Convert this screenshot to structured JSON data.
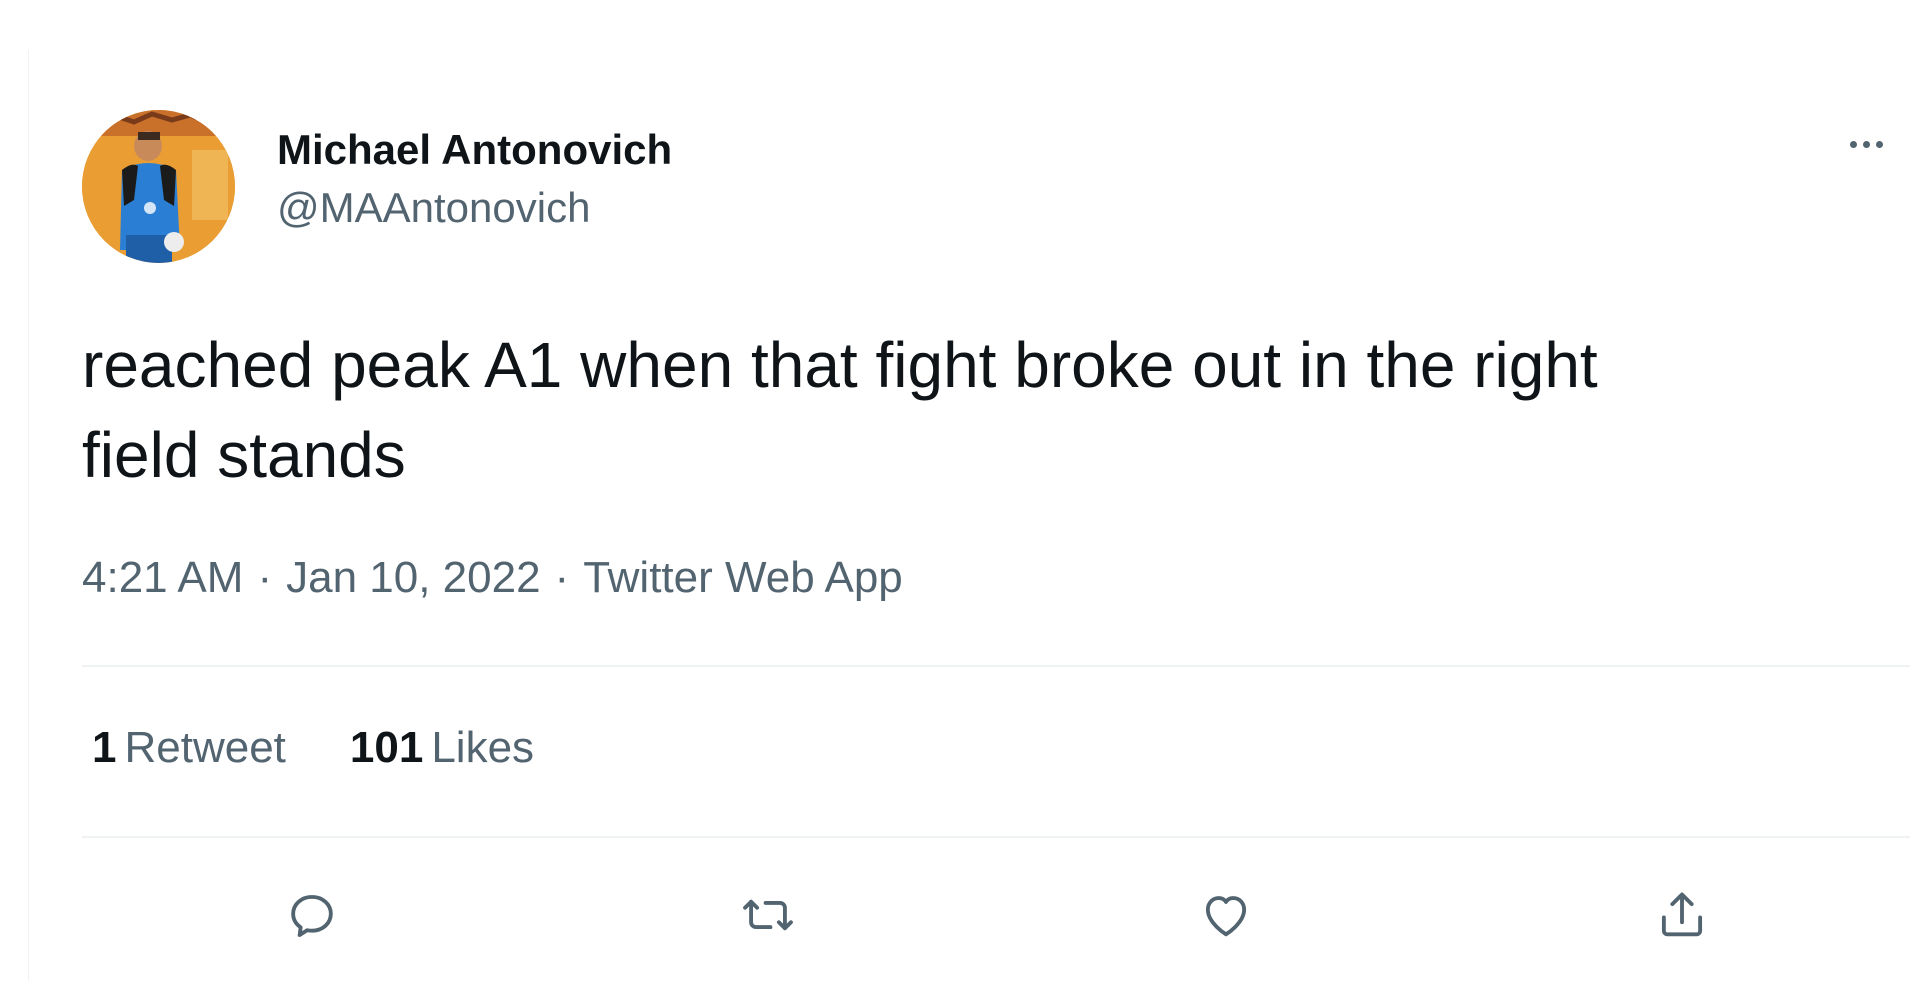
{
  "tweet": {
    "author": {
      "display_name": "Michael Antonovich",
      "handle": "@MAAntonovich"
    },
    "text": "reached peak A1 when that fight broke out in the right\nfield stands",
    "meta": {
      "time": "4:21 AM",
      "separator": "·",
      "date": "Jan 10, 2022",
      "source": "Twitter Web App"
    },
    "stats": {
      "retweets_count": "1",
      "retweets_label": "Retweet",
      "likes_count": "101",
      "likes_label": "Likes"
    },
    "actions": {
      "reply_icon": "reply-bubble-icon",
      "retweet_icon": "retweet-icon",
      "like_icon": "heart-icon",
      "share_icon": "share-icon",
      "more_icon": "more-dots-icon"
    },
    "colors": {
      "primary_text": "#0f1419",
      "secondary_text": "#536471",
      "divider": "#eff3f4",
      "avatar_bg": "#e89b2f",
      "avatar_shirt": "#2a7fd4"
    }
  }
}
